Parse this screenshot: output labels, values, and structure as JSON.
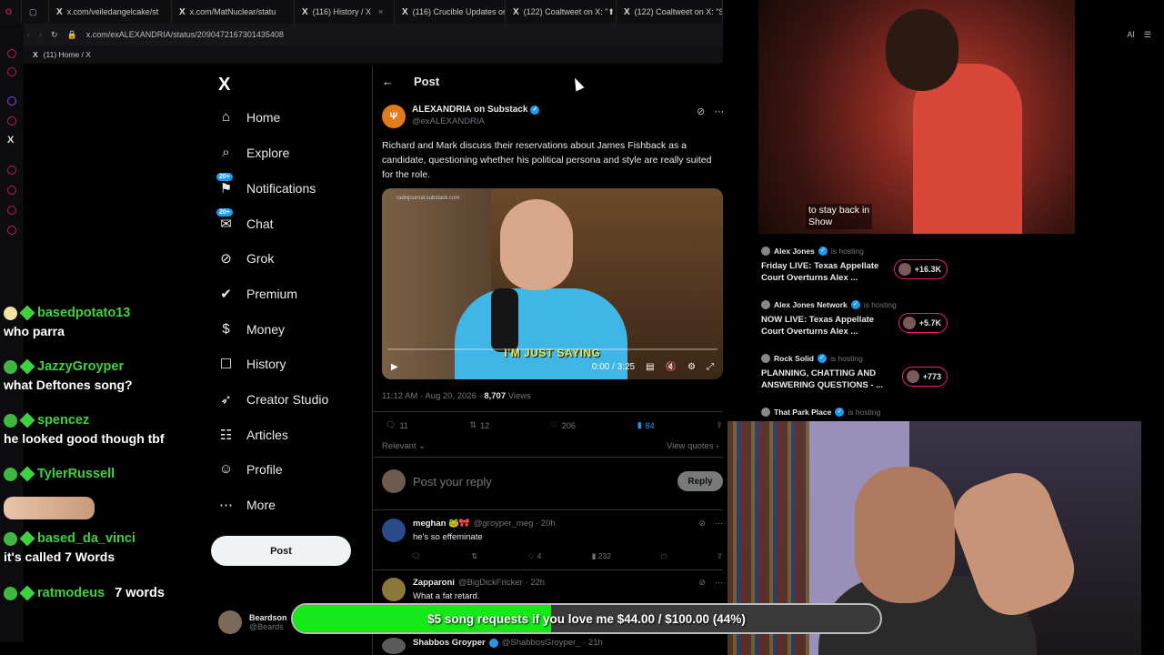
{
  "browser": {
    "tabs": [
      {
        "label": "x.com/veiledangelcake/st"
      },
      {
        "label": "x.com/MatNuclear/statu"
      },
      {
        "label": "(116) History / X"
      },
      {
        "label": "(116) Crucible Updates on"
      },
      {
        "label": "(122) Coaltweet on X: \"⬆"
      },
      {
        "label": "(122) Coaltweet on X: \"S"
      }
    ],
    "url": "x.com/exALEXANDRIA/status/2090472167301435408",
    "bookmark": "(11) Home / X",
    "ai_label": "AI"
  },
  "nav": {
    "logo": "X",
    "items": [
      {
        "label": "Home",
        "icon": "home-icon",
        "glyph": "⌂"
      },
      {
        "label": "Explore",
        "icon": "search-icon",
        "glyph": "⌕"
      },
      {
        "label": "Notifications",
        "icon": "bell-icon",
        "glyph": "⚑",
        "badge": "20+"
      },
      {
        "label": "Chat",
        "icon": "chat-icon",
        "glyph": "✉",
        "badge": "20+"
      },
      {
        "label": "Grok",
        "icon": "grok-icon",
        "glyph": "⊘"
      },
      {
        "label": "Premium",
        "icon": "premium-icon",
        "glyph": "✔"
      },
      {
        "label": "Money",
        "icon": "money-icon",
        "glyph": "$"
      },
      {
        "label": "History",
        "icon": "bookmark-icon",
        "glyph": "☐"
      },
      {
        "label": "Creator Studio",
        "icon": "rocket-icon",
        "glyph": "➶"
      },
      {
        "label": "Articles",
        "icon": "articles-icon",
        "glyph": "☷"
      },
      {
        "label": "Profile",
        "icon": "profile-icon",
        "glyph": "☺"
      },
      {
        "label": "More",
        "icon": "more-icon",
        "glyph": "⋯"
      }
    ],
    "post_button": "Post",
    "account_name": "Beardson",
    "account_handle": "@Beards"
  },
  "post": {
    "header_title": "Post",
    "author_name": "ALEXANDRIA on Substack",
    "author_handle": "@exALEXANDRIA",
    "text": "Richard and Mark discuss their reservations about James Fishback as a candidate, questioning whether his political persona and style are really suited for the role.",
    "video": {
      "site": "radixjournal.substack.com",
      "caption": "I'M JUST SAYING",
      "time": "0:00 / 3:25"
    },
    "time": "11:12 AM · Aug 20, 2026 · ",
    "views_count": "8,707",
    "views_label": " Views",
    "stats": {
      "replies": "11",
      "reposts": "12",
      "likes": "206",
      "bookmarks": "84"
    },
    "relevant": "Relevant",
    "view_quotes": "View quotes",
    "reply_placeholder": "Post your reply",
    "reply_button": "Reply"
  },
  "replies": [
    {
      "name": "meghan 🐸🎀",
      "handle": "@groyper_meg · 20h",
      "text": "he's so effeminate",
      "likes": "4",
      "views": "232"
    },
    {
      "name": "Zapparoni",
      "handle": "@BigDickFricker · 22h",
      "text": "What a fat retard.",
      "likes": "",
      "views": ""
    },
    {
      "name": "Shabbos Groyper",
      "handle": "@ShabbosGroyper_ · 21h",
      "text": "",
      "likes": "",
      "views": ""
    }
  ],
  "stream_top": {
    "subtitle_line1": "to stay back in",
    "subtitle_line2": "Show"
  },
  "live": [
    {
      "host": "Alex Jones",
      "status": "is hosting",
      "title": "Friday LIVE: Texas Appellate Court Overturns Alex ...",
      "count": "+16.3K"
    },
    {
      "host": "Alex Jones Network",
      "status": "is hosting",
      "title": "NOW LIVE: Texas Appellate Court Overturns Alex ...",
      "count": "+5.7K"
    },
    {
      "host": "Rock Solid",
      "status": "is hosting",
      "title": "PLANNING, CHATTING AND ANSWERING QUESTIONS - ...",
      "count": "+773"
    },
    {
      "host": "That Park Place",
      "status": "is hosting",
      "title": "",
      "count": ""
    }
  ],
  "chat": [
    {
      "user": "basedpotato13",
      "color": "#3fd13f",
      "text": "who parra"
    },
    {
      "user": "JazzyGroyper",
      "color": "#3fd13f",
      "text": "what Deftones song?"
    },
    {
      "user": "spencez",
      "color": "#3fd13f",
      "text": "he looked good though tbf"
    },
    {
      "user": "TylerRussell",
      "color": "#3fd13f",
      "text": ""
    },
    {
      "user": "based_da_vinci",
      "color": "#3fd13f",
      "text": "it's called 7 Words"
    },
    {
      "user": "ratmodeus",
      "color": "#3fd13f",
      "text": "7 words"
    }
  ],
  "goal": {
    "label": "$5 song requests if you love me $44.00 / $100.00 (44%)",
    "progress": 0.44
  },
  "colors": {
    "accent": "#1d9bf0",
    "goal_fill": "#17e81a",
    "live_pill": "#f91880"
  }
}
